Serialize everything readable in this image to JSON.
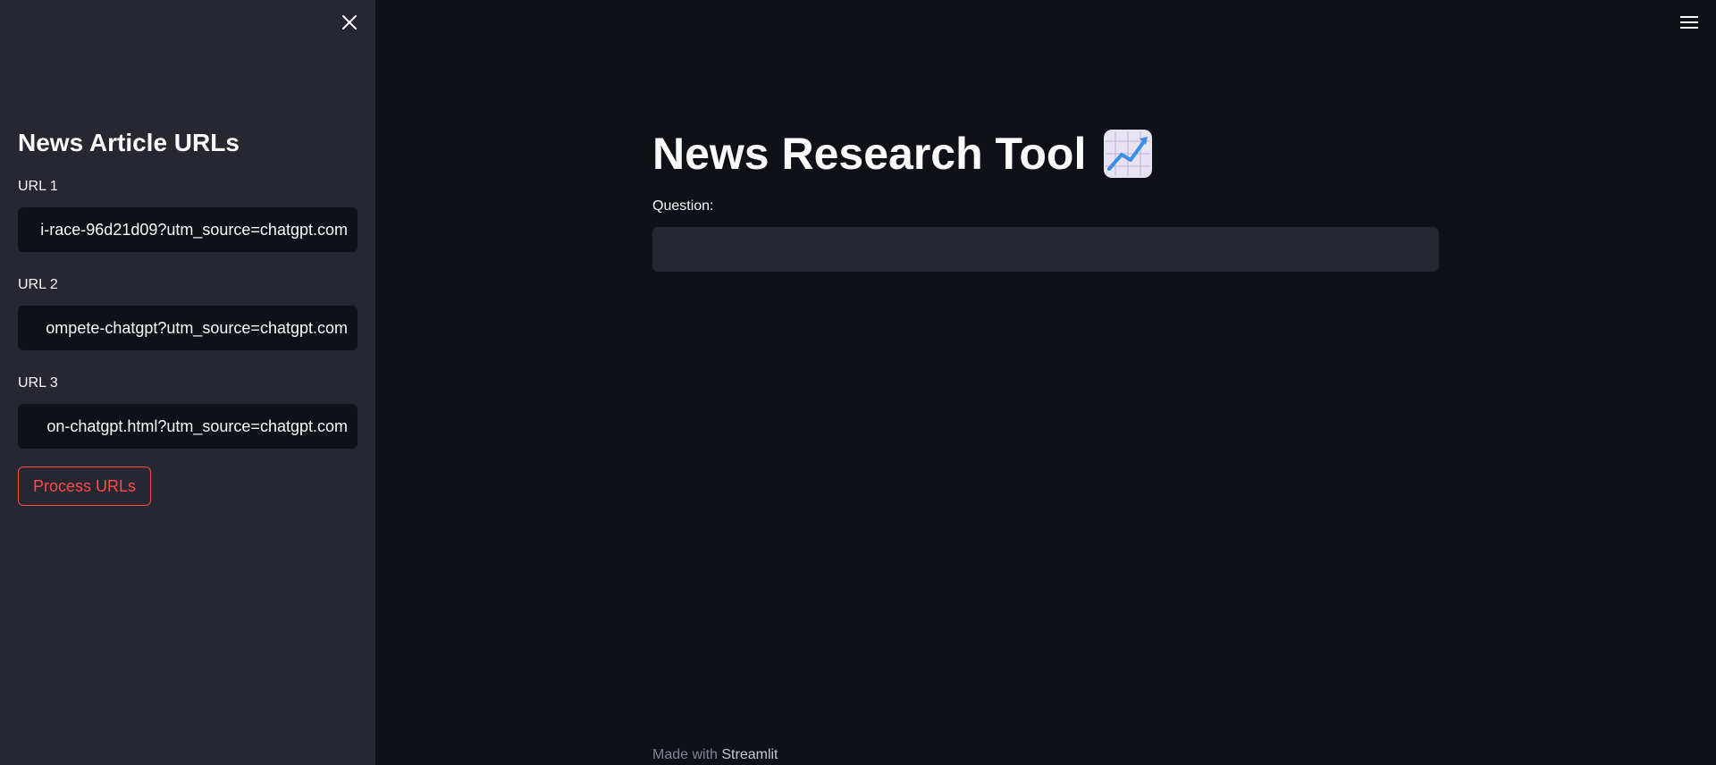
{
  "sidebar": {
    "close_icon": "close-icon",
    "title": "News Article URLs",
    "fields": [
      {
        "label": "URL 1",
        "value": "i-race-96d21d09?utm_source=chatgpt.com"
      },
      {
        "label": "URL 2",
        "value": "ompete-chatgpt?utm_source=chatgpt.com"
      },
      {
        "label": "URL 3",
        "value": "on-chatgpt.html?utm_source=chatgpt.com"
      }
    ],
    "process_button_label": "Process URLs"
  },
  "header": {
    "menu_icon": "hamburger-menu-icon"
  },
  "main": {
    "title": "News Research Tool",
    "title_emoji": "chart-increasing-icon",
    "question_label": "Question:",
    "question_value": ""
  },
  "footer": {
    "prefix": "Made with",
    "link": "Streamlit"
  },
  "colors": {
    "background": "#0e1117",
    "sidebar": "#262730",
    "accent": "#ff4b4b",
    "text": "#fafafa"
  }
}
